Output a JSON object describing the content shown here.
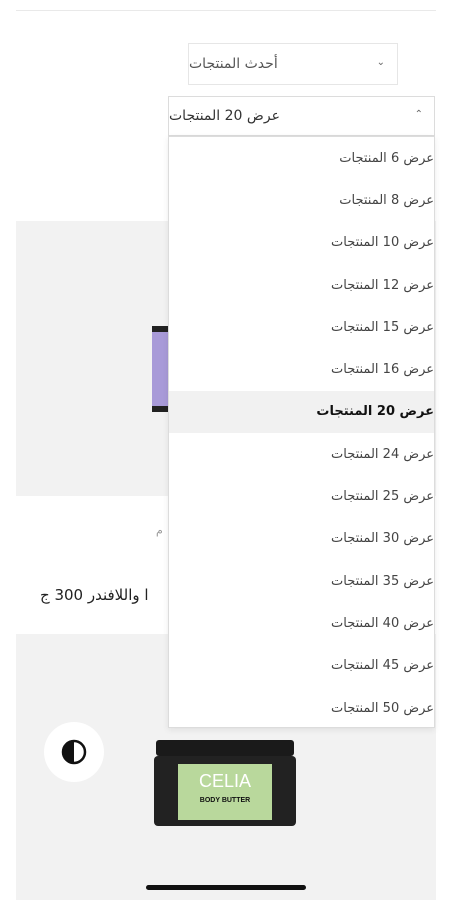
{
  "sort": {
    "selected": "أحدث المنتجات"
  },
  "per_page": {
    "selected": "عرض 20 المنتجات",
    "options": [
      {
        "label": "عرض 6 المنتجات",
        "selected": false
      },
      {
        "label": "عرض 8 المنتجات",
        "selected": false
      },
      {
        "label": "عرض 10 المنتجات",
        "selected": false
      },
      {
        "label": "عرض 12 المنتجات",
        "selected": false
      },
      {
        "label": "عرض 15 المنتجات",
        "selected": false
      },
      {
        "label": "عرض 16 المنتجات",
        "selected": false
      },
      {
        "label": "عرض 20 المنتجات",
        "selected": true
      },
      {
        "label": "عرض 24 المنتجات",
        "selected": false
      },
      {
        "label": "عرض 25 المنتجات",
        "selected": false
      },
      {
        "label": "عرض 30 المنتجات",
        "selected": false
      },
      {
        "label": "عرض 35 المنتجات",
        "selected": false
      },
      {
        "label": "عرض 40 المنتجات",
        "selected": false
      },
      {
        "label": "عرض 45 المنتجات",
        "selected": false
      },
      {
        "label": "عرض 50 المنتجات",
        "selected": false
      }
    ]
  },
  "products": [
    {
      "title_partial": "ا واللافندر 300 ج",
      "meta_partial": "م"
    },
    {
      "brand_text": "CELIA",
      "label_text": "BODY BUTTER"
    }
  ],
  "icons": {
    "sort_chevron": "chevron-down-icon",
    "count_chevron": "chevron-up-icon",
    "contrast": "contrast-icon"
  },
  "colors": {
    "card_bg": "#f2f2f2",
    "selected_option_bg": "#f1f1f1",
    "jar_label": "#b9d89c"
  }
}
